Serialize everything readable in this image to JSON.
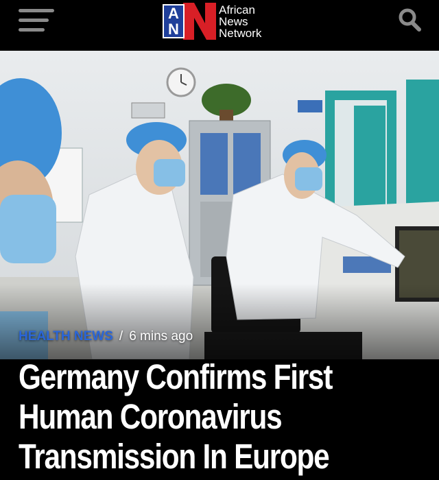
{
  "header": {
    "brand_mark_top": "A",
    "brand_mark_bottom": "N",
    "brand_name": [
      "African",
      "News",
      "Network"
    ],
    "menu_icon": "hamburger-menu-icon",
    "search_icon": "search-icon"
  },
  "article": {
    "category": "HEALTH NEWS",
    "separator": "/",
    "time_ago": "6 mins ago",
    "headline": "Germany Confirms First Human Coronavirus Transmission In Europe"
  },
  "colors": {
    "background": "#000000",
    "brand_blue": "#1f3f9a",
    "brand_red": "#d81f26",
    "category_blue": "#2a66d9",
    "icon_gray": "#8a8a8a"
  }
}
